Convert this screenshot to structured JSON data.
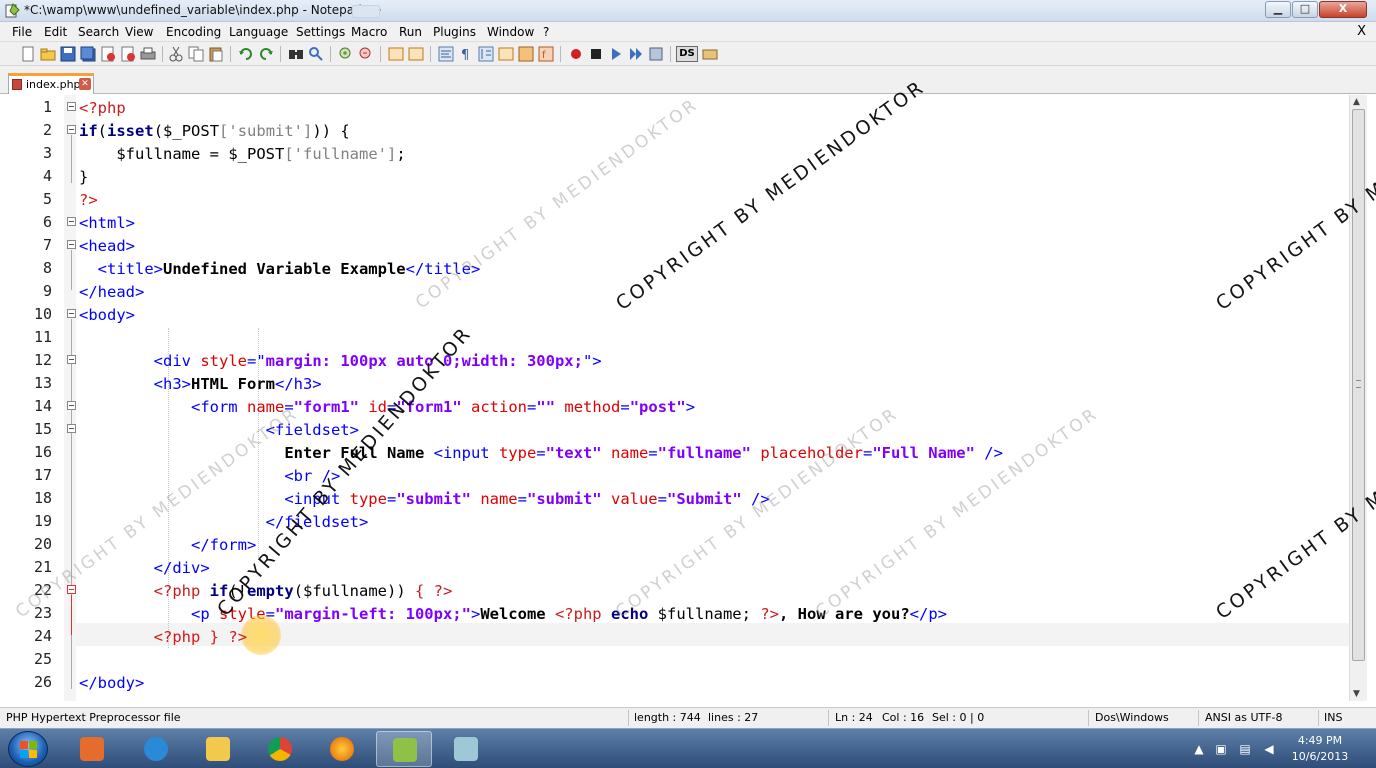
{
  "window": {
    "title": "*C:\\wamp\\www\\undefined_variable\\index.php - Notepad++",
    "min_label": "▁",
    "max_label": "□",
    "close_label": "X"
  },
  "menu": {
    "items": [
      "File",
      "Edit",
      "Search",
      "View",
      "Encoding",
      "Language",
      "Settings",
      "Macro",
      "Run",
      "Plugins",
      "Window",
      "?"
    ],
    "close_x": "X"
  },
  "tabs": [
    {
      "label": "index.php",
      "close": "✕"
    }
  ],
  "toolbar": {
    "ds_label": "DS"
  },
  "editor": {
    "line_numbers": [
      "1",
      "2",
      "3",
      "4",
      "5",
      "6",
      "7",
      "8",
      "9",
      "10",
      "11",
      "12",
      "13",
      "14",
      "15",
      "16",
      "17",
      "18",
      "19",
      "20",
      "21",
      "22",
      "23",
      "24",
      "25",
      "26"
    ],
    "code": {
      "l1_open": "<?php",
      "l2_if": "if",
      "l2_isset": "isset",
      "l2_paren": "(",
      "l2_var": "$_POST",
      "l2_idx": "['submit']",
      "l2_close": ")) {",
      "l3_var": "$fullname",
      "l3_eq": " = ",
      "l3_post": "$_POST",
      "l3_idx": "['fullname']",
      "l3_end": ";",
      "l4": "}",
      "l5": "?>",
      "l6": "<html>",
      "l7": "<head>",
      "l8_open": "<title>",
      "l8_text": "Undefined Variable Example",
      "l8_close": "</title>",
      "l9": "</head>",
      "l10": "<body>",
      "l12_tag": "<div ",
      "l12_attr": "style",
      "l12_eq": "=\"",
      "l12_val": "margin: 100px auto 0;width: 300px;",
      "l12_end": "\">",
      "l13_open": "<h3>",
      "l13_text": "HTML Form",
      "l13_close": "</h3>",
      "l14_tag": "<form ",
      "l14_a1": "name",
      "l14_v1": "\"form1\"",
      "l14_a2": "id",
      "l14_v2": "\"form1\"",
      "l14_a3": "action",
      "l14_v3": "\"\"",
      "l14_a4": "method",
      "l14_v4": "\"post\"",
      "l14_end": ">",
      "l15": "<fieldset>",
      "l16_text": "Enter Full Name ",
      "l16_tag": "<input ",
      "l16_a1": "type",
      "l16_v1": "\"text\"",
      "l16_a2": "name",
      "l16_v2": "\"fullname\"",
      "l16_a3": "placeholder",
      "l16_v3": "\"Full Name\"",
      "l16_end": " />",
      "l17": "<br />",
      "l18_tag": "<input ",
      "l18_a1": "type",
      "l18_v1": "\"submit\"",
      "l18_a2": "name",
      "l18_v2": "\"submit\"",
      "l18_a3": "value",
      "l18_v3": "\"Submit\"",
      "l18_end": " />",
      "l19": "</fieldset>",
      "l20": "</form>",
      "l21": "</div>",
      "l22_php": "<?php",
      "l22_if": "if",
      "l22_paren": "(!",
      "l22_empty": "empty",
      "l22_var": "($fullname))",
      "l22_brace": " {",
      "l22_end": " ?>",
      "l23_tag": "<p ",
      "l23_attr": "style",
      "l23_val": "\"margin-left: 100px;\"",
      "l23_gt": ">",
      "l23_text1": "Welcome ",
      "l23_php": "<?php",
      "l23_echo": "echo",
      "l23_var": "$fullname;",
      "l23_phpend": "?>",
      "l23_text2": ", How are you?",
      "l23_close": "</p>",
      "l24_php": "<?php",
      "l24_brace": "}",
      "l24_end": "?>",
      "l26": "</body>"
    }
  },
  "statusbar": {
    "file_type": "PHP Hypertext Preprocessor file",
    "length": "length : 744",
    "lines": "lines : 27",
    "ln": "Ln : 24",
    "col": "Col : 16",
    "sel": "Sel : 0 | 0",
    "eol": "Dos\\Windows",
    "encoding": "ANSI as UTF-8",
    "mode": "INS"
  },
  "taskbar": {
    "time": "4:49 PM",
    "date": "10/6/2013"
  },
  "watermark": {
    "text": "COPYRIGHT BY MEDIENDOKTOR"
  },
  "colors": {
    "php_tag": "#cc1b1b",
    "keyword": "#000080",
    "html_tag": "#0000ff",
    "attribute": "#e00000",
    "attr_value": "#8000ff",
    "string": "#808080",
    "tab_accent": "#f7a13b",
    "taskbar": "#2e4d78"
  }
}
